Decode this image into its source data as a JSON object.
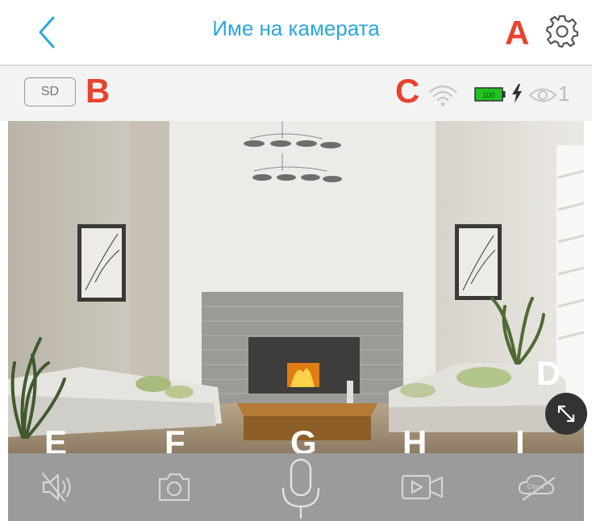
{
  "header": {
    "title": "Име на камерата",
    "back_icon": "chevron-left-icon",
    "settings_icon": "gear-icon"
  },
  "status": {
    "sd_label": "SD",
    "battery_level": "100",
    "viewer_count": "1"
  },
  "markers": {
    "A": "A",
    "B": "B",
    "C": "C",
    "D": "D",
    "E": "E",
    "F": "F",
    "G": "G",
    "H": "H",
    "I": "I"
  },
  "controls": {
    "mute_icon": "speaker-mute-icon",
    "snapshot_icon": "camera-icon",
    "talk_icon": "microphone-icon",
    "record_icon": "video-record-icon",
    "cloud_icon": "cloud-off-icon",
    "cloud_label": "Cloud"
  },
  "colors": {
    "accent": "#2aa6df",
    "marker": "#e8432f",
    "battery": "#22c222",
    "control_bar": "#9b9b9b"
  }
}
